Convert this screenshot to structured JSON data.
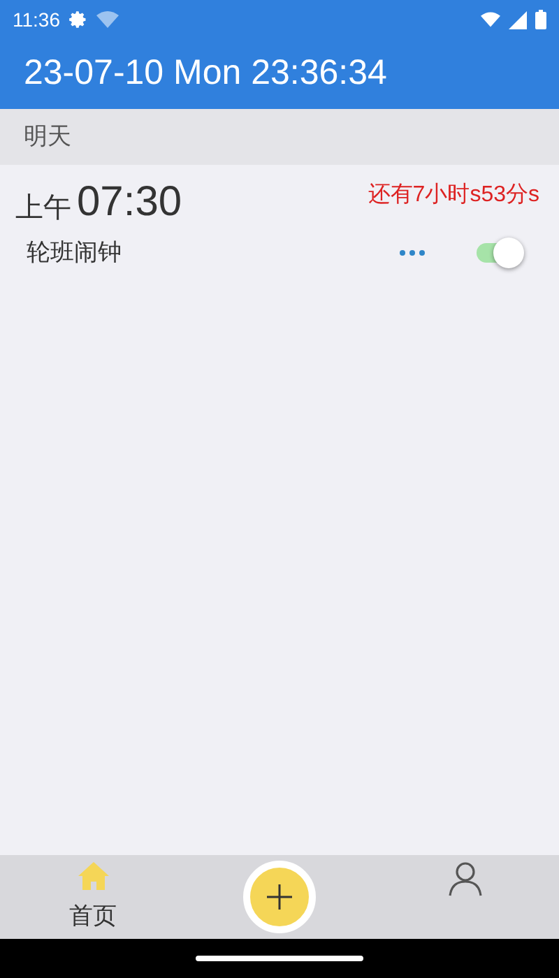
{
  "status_bar": {
    "time": "11:36"
  },
  "header": {
    "title": "23-07-10 Mon 23:36:34"
  },
  "section": {
    "title": "明天"
  },
  "alarms": [
    {
      "period": "上午",
      "time": "07:30",
      "countdown": "还有7小时s53分s",
      "name": "轮班闹钟",
      "on": true
    }
  ],
  "bottom_nav": {
    "tabs": [
      {
        "kind": "home",
        "label": "首页",
        "selected": true
      },
      {
        "kind": "add",
        "selected": false
      },
      {
        "kind": "profile",
        "selected": false
      }
    ]
  }
}
